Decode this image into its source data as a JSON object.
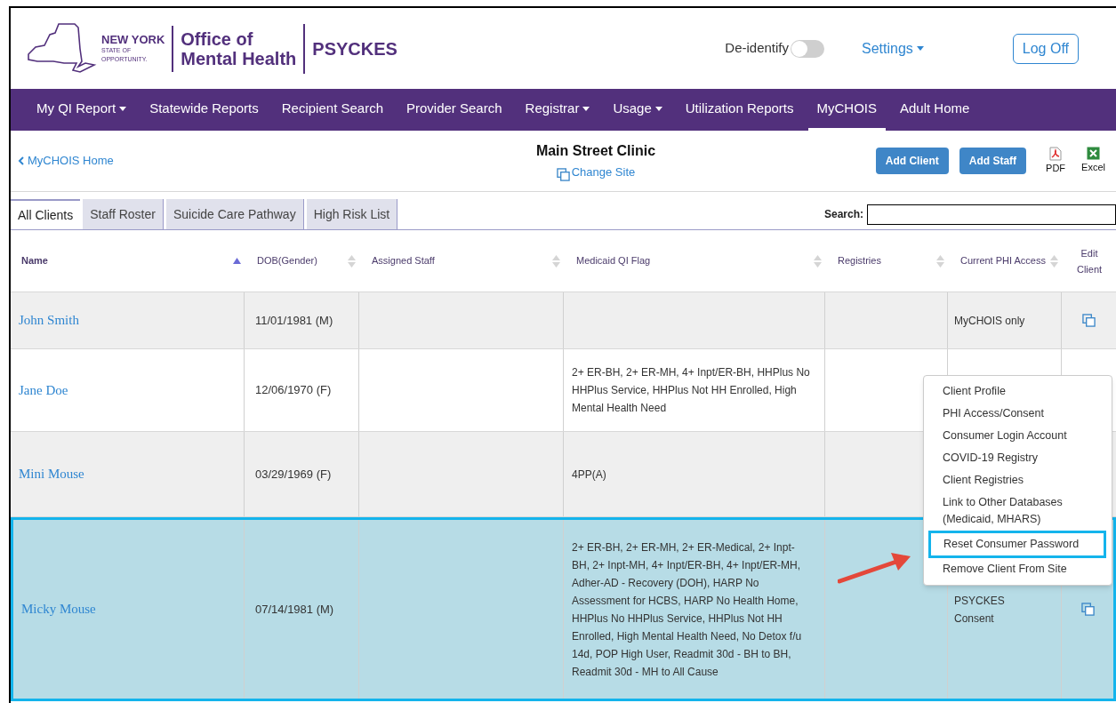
{
  "header": {
    "logo": {
      "line1": "NEW YORK",
      "line2": "STATE OF",
      "line3": "OPPORTUNITY."
    },
    "agency_line1": "Office of",
    "agency_line2": "Mental Health",
    "app_name": "PSYCKES",
    "deidentify": {
      "label": "De-identify",
      "on": false
    },
    "settings": "Settings",
    "logoff": "Log Off"
  },
  "nav": [
    {
      "label": "My QI Report",
      "dropdown": true,
      "selected": false
    },
    {
      "label": "Statewide Reports",
      "dropdown": false,
      "selected": false
    },
    {
      "label": "Recipient Search",
      "dropdown": false,
      "selected": false
    },
    {
      "label": "Provider Search",
      "dropdown": false,
      "selected": false
    },
    {
      "label": "Registrar",
      "dropdown": true,
      "selected": false
    },
    {
      "label": "Usage",
      "dropdown": true,
      "selected": false
    },
    {
      "label": "Utilization Reports",
      "dropdown": false,
      "selected": false
    },
    {
      "label": "MyCHOIS",
      "dropdown": false,
      "selected": true
    },
    {
      "label": "Adult Home",
      "dropdown": false,
      "selected": false
    }
  ],
  "subheader": {
    "back_link": "MyCHOIS Home",
    "site_name": "Main Street Clinic",
    "change_site": "Change Site",
    "buttons": [
      "Add Client",
      "Add Staff"
    ],
    "exports": [
      "PDF",
      "Excel"
    ]
  },
  "tabs": [
    {
      "label": "All Clients",
      "selected": true
    },
    {
      "label": "Staff Roster",
      "selected": false
    },
    {
      "label": "Suicide Care Pathway",
      "selected": false
    },
    {
      "label": "High Risk List",
      "selected": false
    }
  ],
  "search": {
    "label": "Search:"
  },
  "table": {
    "columns": [
      {
        "label": "Name",
        "sorted": true
      },
      {
        "label": "DOB(Gender)",
        "sorted": false
      },
      {
        "label": "Assigned Staff",
        "sorted": false
      },
      {
        "label": "Medicaid QI Flag",
        "sorted": false
      },
      {
        "label": "Registries",
        "sorted": false
      },
      {
        "label": "Current PHI Access",
        "sorted": false
      },
      {
        "label": "Edit Client"
      }
    ],
    "rows": [
      {
        "name": "John Smith",
        "dob": "11/01/1981",
        "gender": "(M)",
        "staff": "",
        "flags": "",
        "registries": "",
        "phi": "MyCHOIS only",
        "edit_icon": true,
        "selected": false
      },
      {
        "name": "Jane Doe",
        "dob": "12/06/1970",
        "gender": "(F)",
        "staff": "",
        "flags": "2+ ER-BH, 2+ ER-MH, 4+ Inpt/ER-BH, HHPlus No HHPlus Service, HHPlus Not HH Enrolled, High Mental Health Need",
        "registries": "",
        "phi": "",
        "selected": false
      },
      {
        "name": "Mini Mouse",
        "dob": "03/29/1969",
        "gender": "(F)",
        "staff": "",
        "flags": "4PP(A)",
        "registries": "",
        "phi": "",
        "selected": false
      },
      {
        "name": "Micky Mouse",
        "dob": "07/14/1981",
        "gender": "(M)",
        "staff": "",
        "flags": "2+ ER-BH, 2+ ER-MH, 2+ ER-Medical, 2+ Inpt-BH, 2+ Inpt-MH, 4+ Inpt/ER-BH, 4+ Inpt/ER-MH, Adher-AD - Recovery (DOH), HARP No Assessment for HCBS, HARP No Health Home, HHPlus No HHPlus Service, HHPlus Not HH Enrolled, High Mental Health Need, No Detox f/u 14d, POP High User, Readmit 30d - BH to BH, Readmit 30d - MH to All Cause",
        "registries": "",
        "phi": "PSYCKES Consent",
        "edit_icon": true,
        "selected": true
      }
    ]
  },
  "menu": [
    {
      "label": "Client Profile",
      "selected": false
    },
    {
      "label": "PHI Access/Consent",
      "selected": false
    },
    {
      "label": "Consumer Login Account",
      "selected": false
    },
    {
      "label": "COVID-19 Registry",
      "selected": false
    },
    {
      "label": "Client Registries",
      "selected": false
    },
    {
      "label": "Link to Other Databases (Medicaid, MHARS)",
      "selected": false
    },
    {
      "label": "Reset Consumer Password",
      "selected": true
    },
    {
      "label": "Remove Client From Site",
      "selected": false
    }
  ]
}
